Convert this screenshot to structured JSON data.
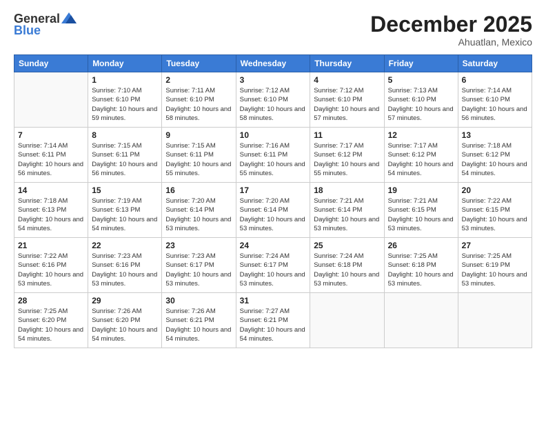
{
  "header": {
    "logo_general": "General",
    "logo_blue": "Blue",
    "month_title": "December 2025",
    "location": "Ahuatlan, Mexico"
  },
  "days_of_week": [
    "Sunday",
    "Monday",
    "Tuesday",
    "Wednesday",
    "Thursday",
    "Friday",
    "Saturday"
  ],
  "weeks": [
    [
      {
        "day": "",
        "sunrise": "",
        "sunset": "",
        "daylight": ""
      },
      {
        "day": "1",
        "sunrise": "Sunrise: 7:10 AM",
        "sunset": "Sunset: 6:10 PM",
        "daylight": "Daylight: 10 hours and 59 minutes."
      },
      {
        "day": "2",
        "sunrise": "Sunrise: 7:11 AM",
        "sunset": "Sunset: 6:10 PM",
        "daylight": "Daylight: 10 hours and 58 minutes."
      },
      {
        "day": "3",
        "sunrise": "Sunrise: 7:12 AM",
        "sunset": "Sunset: 6:10 PM",
        "daylight": "Daylight: 10 hours and 58 minutes."
      },
      {
        "day": "4",
        "sunrise": "Sunrise: 7:12 AM",
        "sunset": "Sunset: 6:10 PM",
        "daylight": "Daylight: 10 hours and 57 minutes."
      },
      {
        "day": "5",
        "sunrise": "Sunrise: 7:13 AM",
        "sunset": "Sunset: 6:10 PM",
        "daylight": "Daylight: 10 hours and 57 minutes."
      },
      {
        "day": "6",
        "sunrise": "Sunrise: 7:14 AM",
        "sunset": "Sunset: 6:10 PM",
        "daylight": "Daylight: 10 hours and 56 minutes."
      }
    ],
    [
      {
        "day": "7",
        "sunrise": "Sunrise: 7:14 AM",
        "sunset": "Sunset: 6:11 PM",
        "daylight": "Daylight: 10 hours and 56 minutes."
      },
      {
        "day": "8",
        "sunrise": "Sunrise: 7:15 AM",
        "sunset": "Sunset: 6:11 PM",
        "daylight": "Daylight: 10 hours and 56 minutes."
      },
      {
        "day": "9",
        "sunrise": "Sunrise: 7:15 AM",
        "sunset": "Sunset: 6:11 PM",
        "daylight": "Daylight: 10 hours and 55 minutes."
      },
      {
        "day": "10",
        "sunrise": "Sunrise: 7:16 AM",
        "sunset": "Sunset: 6:11 PM",
        "daylight": "Daylight: 10 hours and 55 minutes."
      },
      {
        "day": "11",
        "sunrise": "Sunrise: 7:17 AM",
        "sunset": "Sunset: 6:12 PM",
        "daylight": "Daylight: 10 hours and 55 minutes."
      },
      {
        "day": "12",
        "sunrise": "Sunrise: 7:17 AM",
        "sunset": "Sunset: 6:12 PM",
        "daylight": "Daylight: 10 hours and 54 minutes."
      },
      {
        "day": "13",
        "sunrise": "Sunrise: 7:18 AM",
        "sunset": "Sunset: 6:12 PM",
        "daylight": "Daylight: 10 hours and 54 minutes."
      }
    ],
    [
      {
        "day": "14",
        "sunrise": "Sunrise: 7:18 AM",
        "sunset": "Sunset: 6:13 PM",
        "daylight": "Daylight: 10 hours and 54 minutes."
      },
      {
        "day": "15",
        "sunrise": "Sunrise: 7:19 AM",
        "sunset": "Sunset: 6:13 PM",
        "daylight": "Daylight: 10 hours and 54 minutes."
      },
      {
        "day": "16",
        "sunrise": "Sunrise: 7:20 AM",
        "sunset": "Sunset: 6:14 PM",
        "daylight": "Daylight: 10 hours and 53 minutes."
      },
      {
        "day": "17",
        "sunrise": "Sunrise: 7:20 AM",
        "sunset": "Sunset: 6:14 PM",
        "daylight": "Daylight: 10 hours and 53 minutes."
      },
      {
        "day": "18",
        "sunrise": "Sunrise: 7:21 AM",
        "sunset": "Sunset: 6:14 PM",
        "daylight": "Daylight: 10 hours and 53 minutes."
      },
      {
        "day": "19",
        "sunrise": "Sunrise: 7:21 AM",
        "sunset": "Sunset: 6:15 PM",
        "daylight": "Daylight: 10 hours and 53 minutes."
      },
      {
        "day": "20",
        "sunrise": "Sunrise: 7:22 AM",
        "sunset": "Sunset: 6:15 PM",
        "daylight": "Daylight: 10 hours and 53 minutes."
      }
    ],
    [
      {
        "day": "21",
        "sunrise": "Sunrise: 7:22 AM",
        "sunset": "Sunset: 6:16 PM",
        "daylight": "Daylight: 10 hours and 53 minutes."
      },
      {
        "day": "22",
        "sunrise": "Sunrise: 7:23 AM",
        "sunset": "Sunset: 6:16 PM",
        "daylight": "Daylight: 10 hours and 53 minutes."
      },
      {
        "day": "23",
        "sunrise": "Sunrise: 7:23 AM",
        "sunset": "Sunset: 6:17 PM",
        "daylight": "Daylight: 10 hours and 53 minutes."
      },
      {
        "day": "24",
        "sunrise": "Sunrise: 7:24 AM",
        "sunset": "Sunset: 6:17 PM",
        "daylight": "Daylight: 10 hours and 53 minutes."
      },
      {
        "day": "25",
        "sunrise": "Sunrise: 7:24 AM",
        "sunset": "Sunset: 6:18 PM",
        "daylight": "Daylight: 10 hours and 53 minutes."
      },
      {
        "day": "26",
        "sunrise": "Sunrise: 7:25 AM",
        "sunset": "Sunset: 6:18 PM",
        "daylight": "Daylight: 10 hours and 53 minutes."
      },
      {
        "day": "27",
        "sunrise": "Sunrise: 7:25 AM",
        "sunset": "Sunset: 6:19 PM",
        "daylight": "Daylight: 10 hours and 53 minutes."
      }
    ],
    [
      {
        "day": "28",
        "sunrise": "Sunrise: 7:25 AM",
        "sunset": "Sunset: 6:20 PM",
        "daylight": "Daylight: 10 hours and 54 minutes."
      },
      {
        "day": "29",
        "sunrise": "Sunrise: 7:26 AM",
        "sunset": "Sunset: 6:20 PM",
        "daylight": "Daylight: 10 hours and 54 minutes."
      },
      {
        "day": "30",
        "sunrise": "Sunrise: 7:26 AM",
        "sunset": "Sunset: 6:21 PM",
        "daylight": "Daylight: 10 hours and 54 minutes."
      },
      {
        "day": "31",
        "sunrise": "Sunrise: 7:27 AM",
        "sunset": "Sunset: 6:21 PM",
        "daylight": "Daylight: 10 hours and 54 minutes."
      },
      {
        "day": "",
        "sunrise": "",
        "sunset": "",
        "daylight": ""
      },
      {
        "day": "",
        "sunrise": "",
        "sunset": "",
        "daylight": ""
      },
      {
        "day": "",
        "sunrise": "",
        "sunset": "",
        "daylight": ""
      }
    ]
  ]
}
